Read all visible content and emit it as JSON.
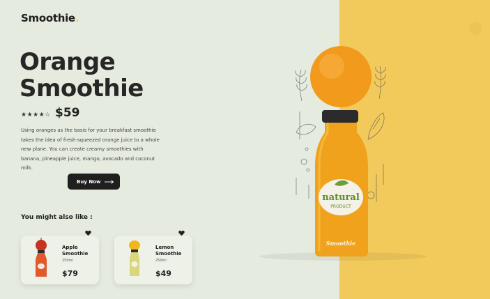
{
  "brand": {
    "name": "Smoothie",
    "dot": "."
  },
  "hero": {
    "title_line1": "Orange",
    "title_line2": "Smoothie",
    "rating": 3.5,
    "stars_text": "★★★★☆",
    "price": "$59",
    "description": "Using oranges as the basis for your breakfast smoothie takes the idea of fresh-squeezed orange juice to a whole new plane. You can create creamy smoothies with banana, pineapple juice, mango, avocado and coconut milk.",
    "buy_label": "Buy Now"
  },
  "product_image": {
    "label_line1": "natural",
    "label_line2": "PRODUCT",
    "bottle_brand": "Smoothie"
  },
  "suggestions": {
    "title": "You might also like :",
    "items": [
      {
        "name_line1": "Apple",
        "name_line2": "Smoothie",
        "volume": "250ml",
        "price": "$79",
        "juice_color": "#e25a2c",
        "fruit_color": "#c8321f"
      },
      {
        "name_line1": "Lemon",
        "name_line2": "Smoothie",
        "volume": "250ml",
        "price": "$49",
        "juice_color": "#d9d77a",
        "fruit_color": "#f0b81c"
      }
    ]
  },
  "colors": {
    "background": "#e6ebdf",
    "accent_panel": "#f2c95b",
    "orange": "#f29a1c",
    "dark": "#1f1f1f"
  }
}
